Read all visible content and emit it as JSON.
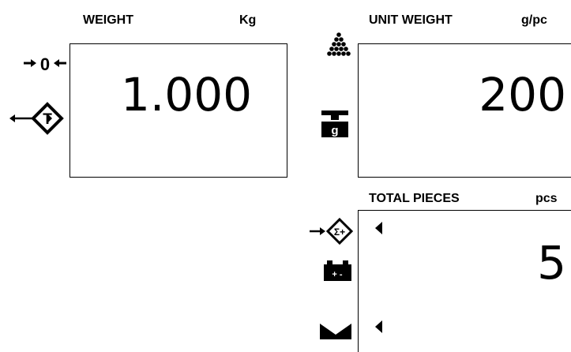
{
  "weight": {
    "label": "WEIGHT",
    "unit": "Kg",
    "value": "1.000"
  },
  "unit_weight": {
    "label": "UNIT WEIGHT",
    "unit": "g/pc",
    "value": "200"
  },
  "total_pieces": {
    "label": "TOTAL PIECES",
    "unit": "pcs",
    "value": "5"
  },
  "icons": {
    "zero": "zero-indicator-icon",
    "tare": "tare-indicator-icon",
    "pieces": "pieces-pile-icon",
    "gram_weight": "gram-weight-icon",
    "accumulate": "accumulate-sum-icon",
    "battery": "battery-icon",
    "zero_glyph": "0",
    "tare_glyph": "T",
    "sum_glyph": "Σ+",
    "gram_glyph": "g",
    "battery_glyph": "+ -"
  }
}
